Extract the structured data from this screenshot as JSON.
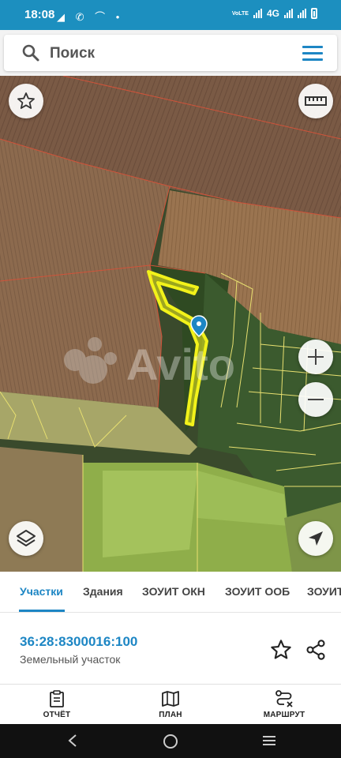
{
  "status_bar": {
    "time": "18:08",
    "left_icons": "◢ ✆ ⌒ •",
    "network_label": "4G",
    "volte_label": "VoLTE"
  },
  "search": {
    "placeholder": "Поиск"
  },
  "map": {
    "watermark": "Avito",
    "buttons": [
      "favorite-star",
      "ruler",
      "zoom-in",
      "zoom-out",
      "layers",
      "my-location"
    ]
  },
  "tabs": [
    {
      "label": "Участки",
      "active": true
    },
    {
      "label": "Здания",
      "active": false
    },
    {
      "label": "ЗОУИТ ОКН",
      "active": false
    },
    {
      "label": "ЗОУИТ ООБ",
      "active": false
    },
    {
      "label": "ЗОУИТ",
      "active": false
    }
  ],
  "parcel": {
    "number": "36:28:8300016:100",
    "type": "Земельный участок"
  },
  "actions": [
    {
      "label": "ОТЧЁТ",
      "icon": "report-icon"
    },
    {
      "label": "ПЛАН",
      "icon": "map-plan-icon"
    },
    {
      "label": "МАРШРУТ",
      "icon": "route-icon"
    }
  ],
  "colors": {
    "accent": "#1d86c4",
    "status_bar": "#1c8fbf",
    "highlight_parcel": "#f2f21a"
  }
}
